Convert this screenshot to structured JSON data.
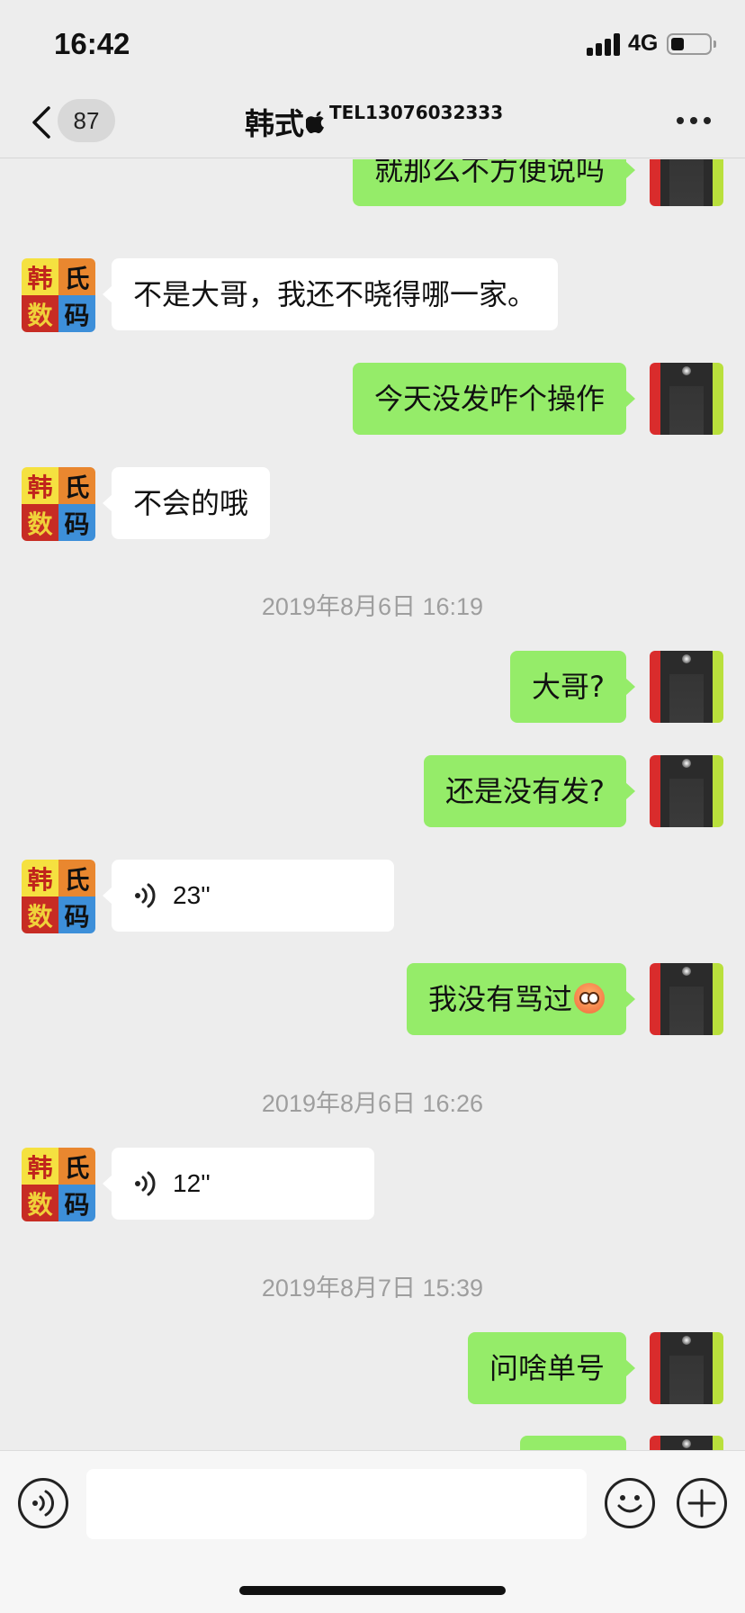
{
  "status_bar": {
    "time": "16:42",
    "network": "4G",
    "signal_bars": 4,
    "battery_level": 0.3
  },
  "nav": {
    "unread_count": "87",
    "title_name": "韩式",
    "title_icon": "apple-icon",
    "title_tel": "TEL13076032333",
    "more_icon": "more-icon"
  },
  "messages": [
    {
      "side": "out",
      "type": "text",
      "text": "就那么不方便说吗"
    },
    {
      "side": "in",
      "type": "text",
      "text": "不是大哥，我还不晓得哪一家。"
    },
    {
      "side": "out",
      "type": "text",
      "text": "今天没发咋个操作"
    },
    {
      "side": "in",
      "type": "text",
      "text": "不会的哦"
    },
    {
      "type": "timestamp",
      "text": "2019年8月6日 16:19"
    },
    {
      "side": "out",
      "type": "text",
      "text": "大哥?"
    },
    {
      "side": "out",
      "type": "text",
      "text": "还是没有发?"
    },
    {
      "side": "in",
      "type": "voice",
      "text": "23''"
    },
    {
      "side": "out",
      "type": "text",
      "text": "我没有骂过",
      "emoji": "flushed-face-emoji"
    },
    {
      "type": "timestamp",
      "text": "2019年8月6日 16:26"
    },
    {
      "side": "in",
      "type": "voice",
      "text": "12''"
    },
    {
      "type": "timestamp",
      "text": "2019年8月7日 15:39"
    },
    {
      "side": "out",
      "type": "text",
      "text": "问啥单号"
    }
  ],
  "contact_avatar": {
    "chars": [
      "韩",
      "氏",
      "数",
      "码"
    ],
    "colors": [
      "#f5e140",
      "#e9872f",
      "#c72c24",
      "#3d8fd9"
    ]
  },
  "input_bar": {
    "value": "",
    "voice_icon": "voice-mode-icon",
    "emoji_icon": "emoji-icon",
    "plus_icon": "plus-icon"
  },
  "colors": {
    "outgoing_bubble": "#95ec69",
    "incoming_bubble": "#ffffff",
    "background": "#ededed",
    "timestamp_text": "#9e9e9e"
  }
}
